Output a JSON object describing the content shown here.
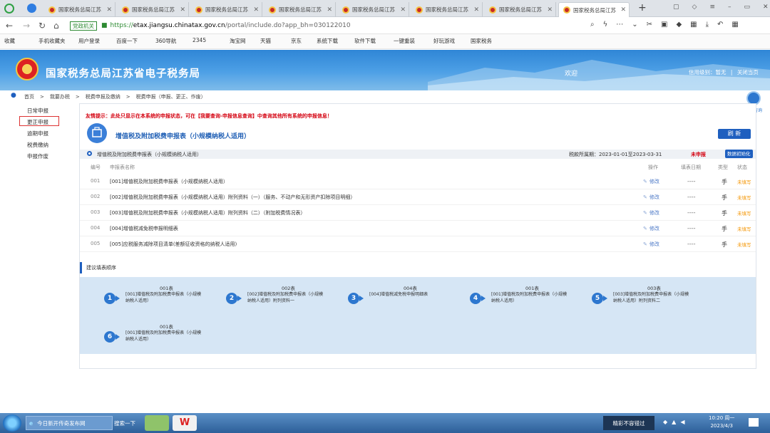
{
  "browser": {
    "tabs": [
      {
        "label": "国家税务总局江苏"
      },
      {
        "label": "国家税务总局江苏"
      },
      {
        "label": "国家税务总局江苏"
      },
      {
        "label": "国家税务总局江苏"
      },
      {
        "label": "国家税务总局江苏"
      },
      {
        "label": "国家税务总局江苏"
      },
      {
        "label": "国家税务总局江苏"
      },
      {
        "label": "国家税务总局江苏"
      }
    ],
    "url_badge": "党政机关",
    "url_scheme": "https://",
    "url_host": "etax.jiangsu.chinatax.gov.cn",
    "url_path": "/portal/include.do?app_bh=030122010",
    "bookmarks": [
      "收藏",
      "手机收藏夹",
      "用户登录",
      "百度一下",
      "360导航",
      "2345",
      "淘宝网",
      "天猫",
      "京东",
      "系统下载",
      "软件下载",
      "一键重装",
      "好玩游戏",
      "国家税务"
    ]
  },
  "header": {
    "title": "国家税务总局江苏省电子税务局",
    "greeting": "欢迎",
    "credit_level": "信用级别：暂无",
    "separator": "|",
    "close_link": "关闭当页"
  },
  "breadcrumb": {
    "items": [
      "首页",
      "我要办税",
      "税费申报及缴纳",
      "税费申报（申报、更正、作废）"
    ],
    "sep": ">"
  },
  "sidebar": {
    "items": [
      {
        "label": "日常申报"
      },
      {
        "label": "更正申报"
      },
      {
        "label": "逾期申报"
      },
      {
        "label": "税费缴纳"
      },
      {
        "label": "申报作废"
      }
    ]
  },
  "floating": {
    "label": "智能咨询"
  },
  "panel": {
    "notice": "友情提示：此处只显示在本系统的申报状态，可在【我要查询-申报信息查询】中查询其他所有系统的申报信息！",
    "form_title": "增值税及附加税费申报表（小规模纳税人适用）",
    "refresh_label": "刷 新",
    "summary_name": "增值税及附加税费申报表（小规模纳税人适用）",
    "summary_period": "税款所属期：2023-01-01至2023-03-31",
    "summary_status": "未申报",
    "summary_button": "数据初始化",
    "columns": {
      "no": "编号",
      "name": "申报表名称",
      "op": "操作",
      "date": "填表日期",
      "type": "类型",
      "status": "状态"
    },
    "rows": [
      {
        "no": "001",
        "name": "[001]增值税及附加税费申报表（小规模纳税人适用）",
        "op": "修改",
        "date": "----",
        "type": "手",
        "status": "未填写"
      },
      {
        "no": "002",
        "name": "[002]增值税及附加税费申报表（小规模纳税人适用）附列资料（一）（服务、不动产和无形资产扣除项目明细）",
        "op": "修改",
        "date": "----",
        "type": "手",
        "status": "未填写"
      },
      {
        "no": "003",
        "name": "[003]增值税及附加税费申报表（小规模纳税人适用）附列资料（二）（附加税费情况表）",
        "op": "修改",
        "date": "----",
        "type": "手",
        "status": "未填写"
      },
      {
        "no": "004",
        "name": "[004]增值税减免税申报明细表",
        "op": "修改",
        "date": "----",
        "type": "手",
        "status": "未填写"
      },
      {
        "no": "005",
        "name": "[005]应税服务减除项目清单(差额征收资格的纳税人适用)",
        "op": "修改",
        "date": "----",
        "type": "手",
        "status": "未填写"
      }
    ],
    "order_label": "建议填表顺序",
    "steps": [
      {
        "n": "1",
        "code": "001表",
        "desc": "[001]增值税及附加税费申报表（小规模纳税人适用）"
      },
      {
        "n": "2",
        "code": "002表",
        "desc": "[002]增值税及附加税费申报表（小规模纳税人适用）附列资料一"
      },
      {
        "n": "3",
        "code": "004表",
        "desc": "[004]增值税减免税申报明细表"
      },
      {
        "n": "4",
        "code": "001表",
        "desc": "[001]增值税及附加税费申报表（小规模纳税人适用）"
      },
      {
        "n": "5",
        "code": "003表",
        "desc": "[003]增值税及附加税费申报表（小规模纳税人适用）附列资料二"
      },
      {
        "n": "6",
        "code": "001表",
        "desc": "[001]增值税及附加税费申报表（小规模纳税人适用）"
      }
    ]
  },
  "taskbar": {
    "ie_label": "今日新开传奇发布网",
    "search_label": "搜索一下",
    "promo": "精彩不容错过",
    "time": "10:20 周一",
    "date": "2023/4/3"
  }
}
